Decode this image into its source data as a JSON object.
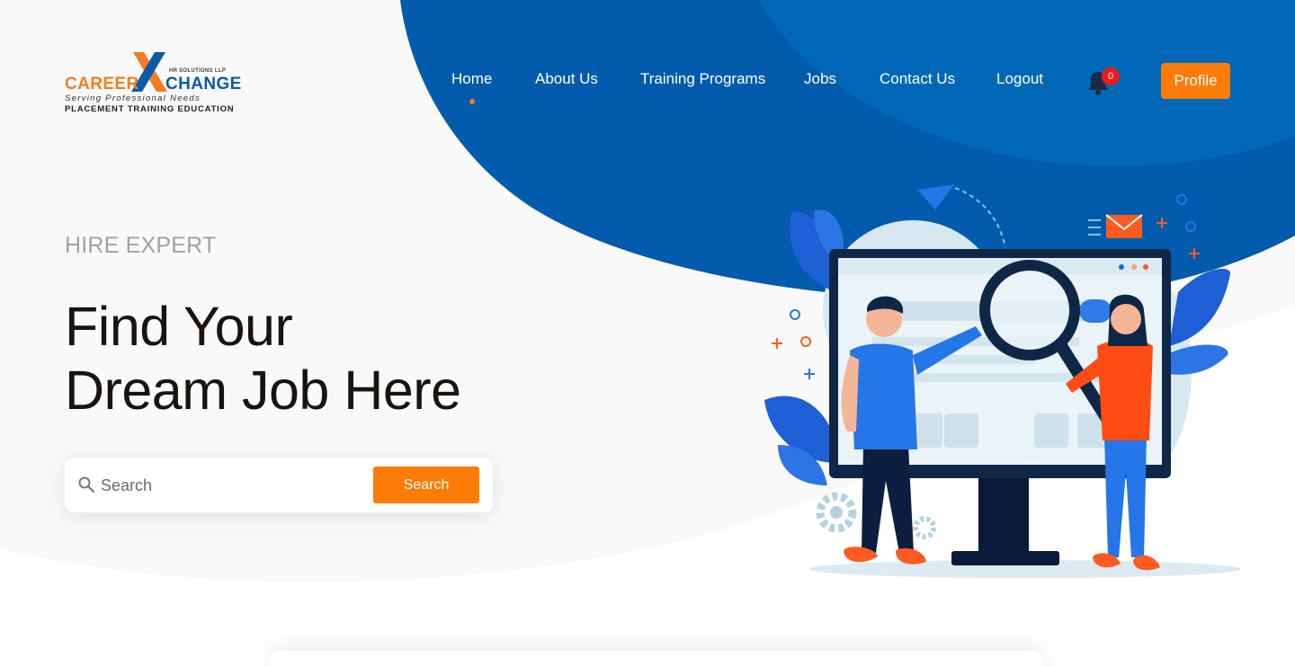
{
  "logo": {
    "word1": "CAREER",
    "word2": "CHANGE",
    "suffix": "HR SOLUTIONS LLP",
    "tagline": "Serving Professional Needs",
    "services": "PLACEMENT   TRAINING   EDUCATION"
  },
  "nav": {
    "items": [
      {
        "label": "Home",
        "active": true
      },
      {
        "label": "About Us"
      },
      {
        "label": "Training Programs"
      },
      {
        "label": "Jobs"
      },
      {
        "label": "Contact Us"
      },
      {
        "label": "Logout"
      }
    ],
    "notification_count": "0",
    "profile_label": "Profile"
  },
  "hero": {
    "eyebrow": "HIRE EXPERT",
    "headline_line1": "Find Your",
    "headline_line2": "Dream Job Here"
  },
  "search": {
    "placeholder": "Search",
    "button_label": "Search"
  },
  "colors": {
    "accent_orange": "#fd7b07",
    "brand_blue": "#0a5aa8",
    "hero_blue": "#025bac",
    "badge_red": "#e81d1d"
  }
}
